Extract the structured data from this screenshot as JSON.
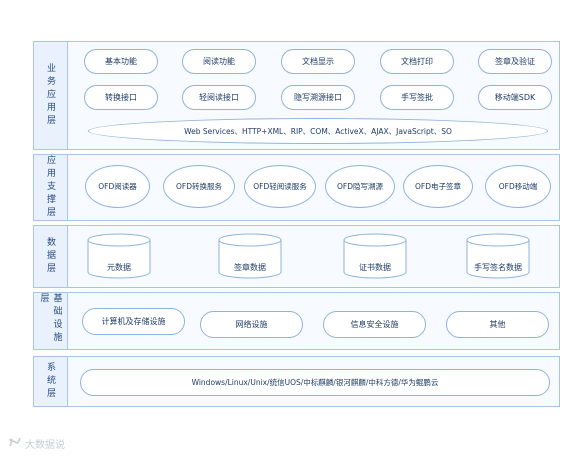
{
  "layers": {
    "business": {
      "label": "业务应用层",
      "row1": [
        "基本功能",
        "阅读功能",
        "文档显示",
        "文档打印",
        "签章及验证"
      ],
      "row2": [
        "转换接口",
        "轻阅读接口",
        "隐写溯源接口",
        "手写签批",
        "移动端SDK"
      ],
      "interfaces": "Web Services、HTTP+XML、RIP、COM、ActiveX、AJAX、JavaScript、SO"
    },
    "support": {
      "label": "应用支撑层",
      "items": [
        "OFD阅读器",
        "OFD转换服务",
        "OFD轻阅读服务",
        "OFD隐写溯源",
        "OFD电子签章",
        "OFD移动端"
      ]
    },
    "data": {
      "label": "数据层",
      "items": [
        "元数据",
        "签章数据",
        "证书数据",
        "手写签名数据"
      ]
    },
    "infra": {
      "label": "基础设施层",
      "items": [
        "计算机及存储设施",
        "网络设施",
        "信息安全设施",
        "其他"
      ]
    },
    "system": {
      "label": "系统层",
      "platforms": "Windows/Linux/Unix/统信UOS/中标麒麟/银河麒麟/中科方德/华为鲲鹏云"
    }
  },
  "watermark": "大数据说"
}
